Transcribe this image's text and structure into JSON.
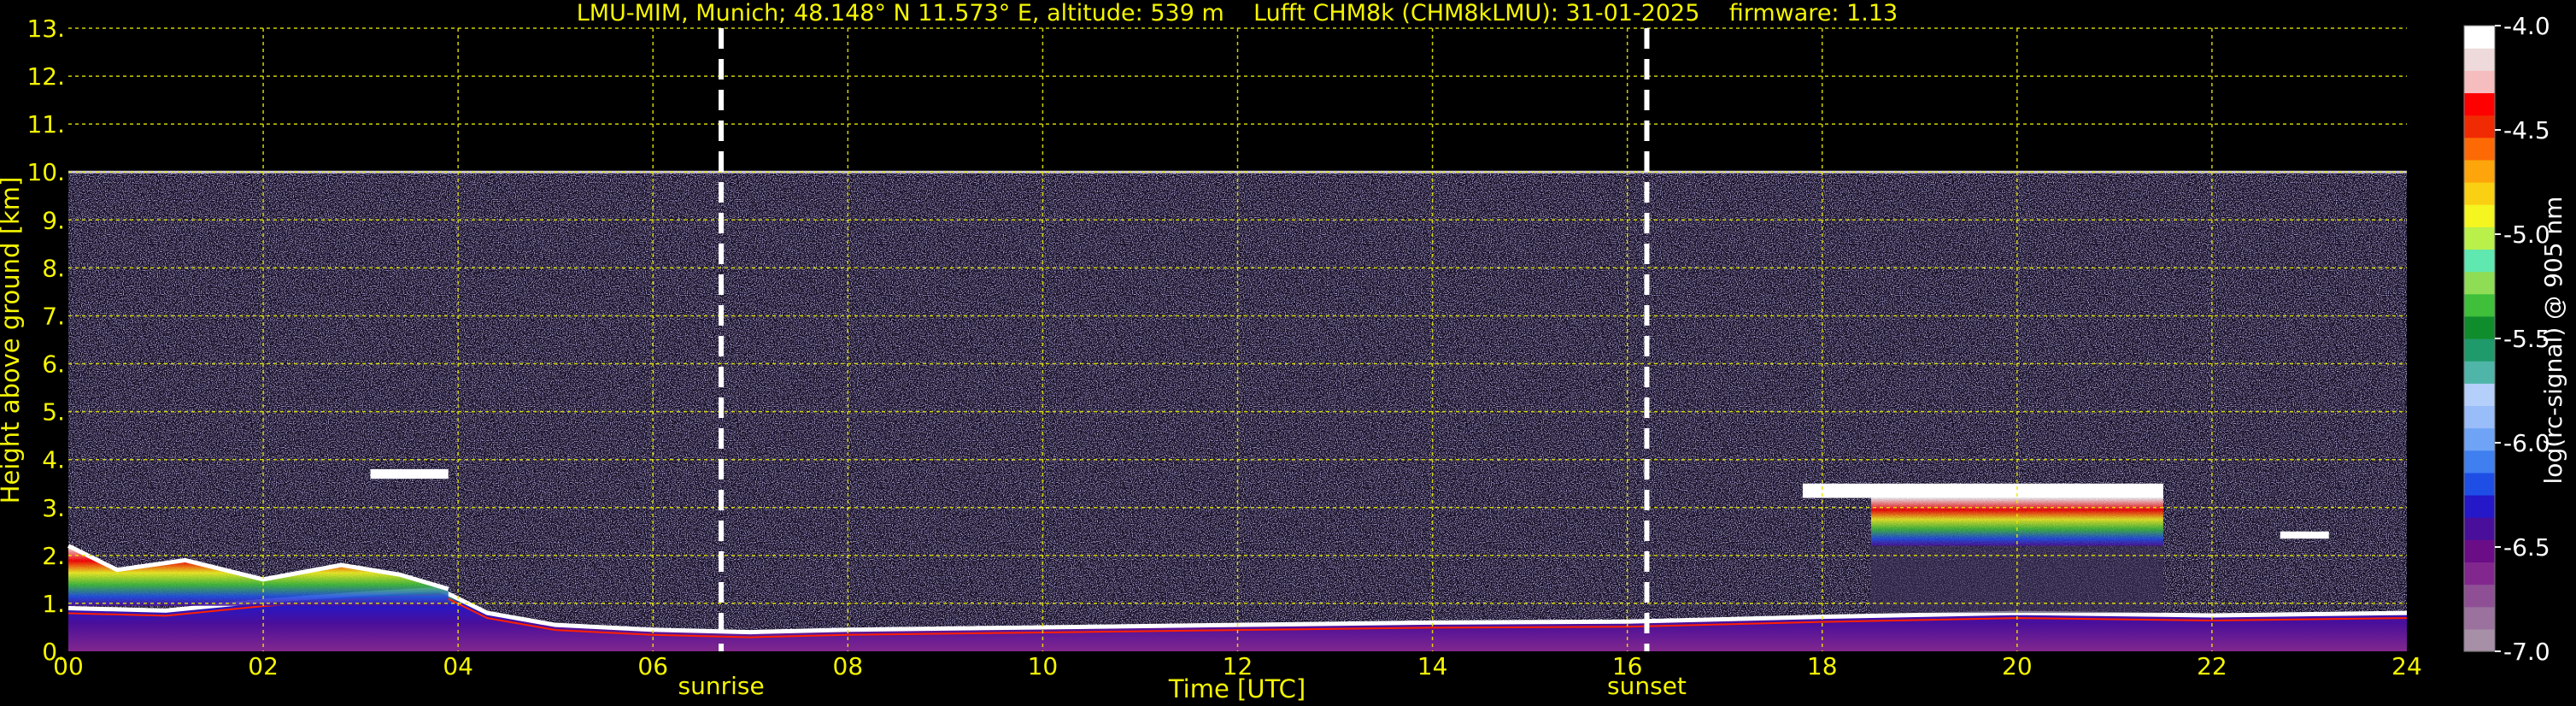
{
  "chart_data": {
    "type": "heatmap",
    "title": "LMU-MIM, Munich; 48.148° N 11.573° E, altitude: 539 m    Lufft CHM8k (CHM8kLMU): 31-01-2025    firmware: 1.13",
    "xlabel": "Time [UTC]",
    "ylabel": "Height above ground [km]",
    "xlim": [
      0,
      24
    ],
    "ylim": [
      0,
      13
    ],
    "x_ticks": [
      "00",
      "02",
      "04",
      "06",
      "08",
      "10",
      "12",
      "14",
      "16",
      "18",
      "20",
      "22",
      "24"
    ],
    "y_ticks": [
      "0.",
      "1.",
      "2.",
      "3.",
      "4.",
      "5.",
      "6.",
      "7.",
      "8.",
      "9.",
      "10.",
      "11.",
      "12.",
      "13."
    ],
    "grid": true,
    "noise_top_km": 10.0,
    "markers": [
      {
        "label": "sunrise",
        "time": 6.7
      },
      {
        "label": "sunset",
        "time": 16.2
      }
    ],
    "colorbar": {
      "label": "log(rc-signal) @ 905 nm",
      "range": [
        -7.0,
        -4.0
      ],
      "ticks": [
        "-4.0",
        "-4.5",
        "-5.0",
        "-5.5",
        "-6.0",
        "-6.5",
        "-7.0"
      ],
      "colors": [
        "#a78fa8",
        "#9b729d",
        "#8f4f95",
        "#82278e",
        "#6a0d86",
        "#4a0f9a",
        "#2418c8",
        "#1f4ee6",
        "#3f7ff0",
        "#6fa3f5",
        "#99bdf9",
        "#b5cffb",
        "#4fb5a8",
        "#1f9a6a",
        "#0f8c2c",
        "#3fbf3a",
        "#8fdc55",
        "#5fe8b0",
        "#b9f04a",
        "#f5f520",
        "#fad012",
        "#fda50a",
        "#fd6a05",
        "#f02a02",
        "#ff0000",
        "#f5bdbd",
        "#eedada",
        "#ffffff"
      ]
    },
    "layers": [
      {
        "name": "boundary-layer",
        "points": [
          [
            0,
            0.9
          ],
          [
            1,
            0.85
          ],
          [
            2,
            1.05
          ],
          [
            3,
            1.2
          ],
          [
            3.8,
            1.3
          ],
          [
            4.3,
            0.8
          ],
          [
            5,
            0.55
          ],
          [
            6,
            0.45
          ],
          [
            7,
            0.4
          ],
          [
            8,
            0.45
          ],
          [
            10,
            0.5
          ],
          [
            12,
            0.55
          ],
          [
            14,
            0.6
          ],
          [
            16,
            0.62
          ],
          [
            18,
            0.72
          ],
          [
            20,
            0.8
          ],
          [
            22,
            0.75
          ],
          [
            24,
            0.8
          ]
        ]
      },
      {
        "name": "cloud-low",
        "points": [
          [
            0,
            2.2
          ],
          [
            0.5,
            1.7
          ],
          [
            1.2,
            1.9
          ],
          [
            2.0,
            1.5
          ],
          [
            2.8,
            1.8
          ],
          [
            3.4,
            1.6
          ],
          [
            3.9,
            1.3
          ]
        ]
      },
      {
        "name": "cloud-midlevel-morning",
        "start": 3.1,
        "end": 3.9,
        "base_km": 3.6,
        "top_km": 3.8
      },
      {
        "name": "cloud-evening",
        "start": 17.8,
        "end": 21.5,
        "base_km": 3.2,
        "top_km": 3.5
      },
      {
        "name": "cloud-late",
        "start": 22.7,
        "end": 23.2,
        "base_km": 2.35,
        "top_km": 2.5
      }
    ]
  }
}
